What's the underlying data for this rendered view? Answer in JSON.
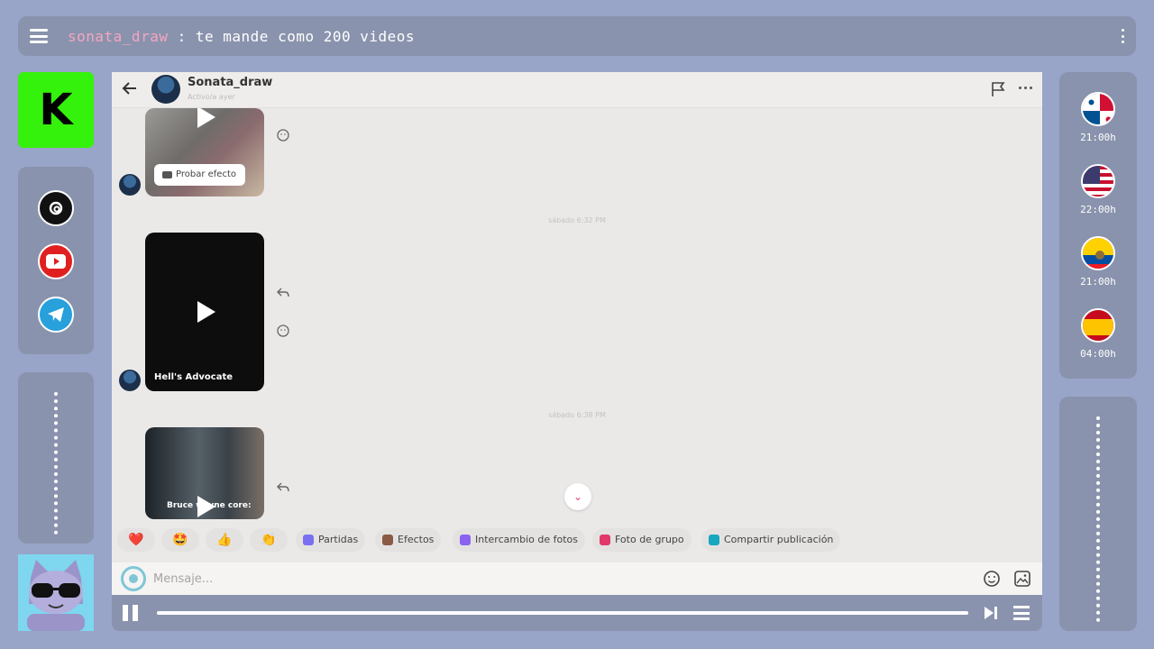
{
  "topbar": {
    "username": "sonata_draw",
    "separator": " : ",
    "message": "te mande como 200 videos"
  },
  "kick": {
    "letter": "K"
  },
  "socials": [
    "threads-icon",
    "youtube-icon",
    "telegram-icon"
  ],
  "flags": [
    {
      "name": "panama-flag-icon",
      "time": "21:00h"
    },
    {
      "name": "usa-flag-icon",
      "time": "22:00h"
    },
    {
      "name": "ecuador-flag-icon",
      "time": "21:00h"
    },
    {
      "name": "spain-flag-icon",
      "time": "04:00h"
    }
  ],
  "chat": {
    "header": {
      "name": "Sonata_draw",
      "status": "Activo/a ayer"
    },
    "messages": [
      {
        "type": "video",
        "button": "Probar efecto"
      },
      {
        "timestamp": "sábado 6:32 PM"
      },
      {
        "type": "video",
        "label": "Hell's Advocate"
      },
      {
        "timestamp": "sábado 6:38 PM"
      },
      {
        "type": "video",
        "label": "Bruce wayne core:"
      }
    ],
    "chips": [
      "Partidas",
      "Efectos",
      "Intercambio de fotos",
      "Foto de grupo",
      "Compartir publicación"
    ],
    "emoji": [
      "❤️",
      "🤩",
      "👍",
      "👏"
    ],
    "composer": {
      "placeholder": "Mensaje..."
    }
  },
  "player": {
    "progress_pct": 100
  },
  "colors": {
    "bg": "#98a4c8",
    "panel": "#8a93ad",
    "kick": "#35f20c",
    "accent_pink": "#f4a6c0"
  }
}
